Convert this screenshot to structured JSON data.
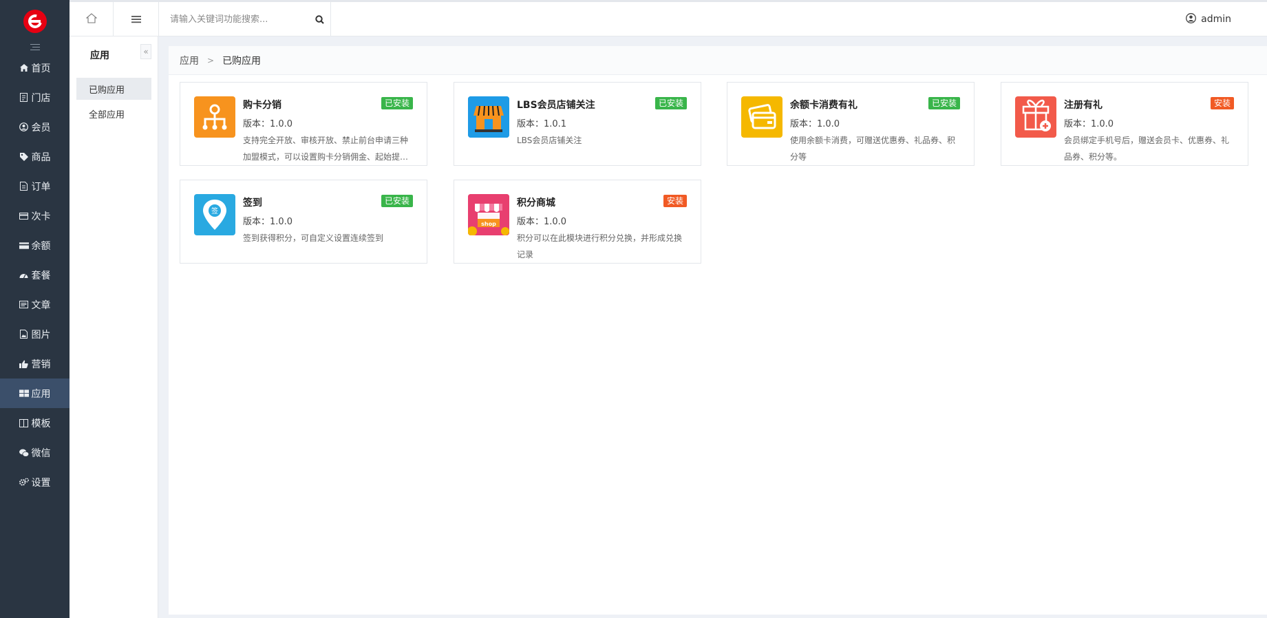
{
  "colors": {
    "sidebar_bg": "#2a3542",
    "sidebar_active": "#3b4f6a",
    "badge_installed": "#39b54a",
    "badge_install": "#f15a24"
  },
  "sidebar": {
    "logo_icon": "brand-logo-icon",
    "items": [
      {
        "label": "首页",
        "icon": "home-icon"
      },
      {
        "label": "门店",
        "icon": "store-icon"
      },
      {
        "label": "会员",
        "icon": "member-icon"
      },
      {
        "label": "商品",
        "icon": "tag-icon"
      },
      {
        "label": "订单",
        "icon": "order-icon"
      },
      {
        "label": "次卡",
        "icon": "card-icon"
      },
      {
        "label": "余额",
        "icon": "balance-icon"
      },
      {
        "label": "套餐",
        "icon": "package-icon"
      },
      {
        "label": "文章",
        "icon": "article-icon"
      },
      {
        "label": "图片",
        "icon": "image-icon"
      },
      {
        "label": "营销",
        "icon": "thumbs-up-icon"
      },
      {
        "label": "应用",
        "icon": "apps-grid-icon",
        "active": true
      },
      {
        "label": "模板",
        "icon": "template-icon"
      },
      {
        "label": "微信",
        "icon": "wechat-icon"
      },
      {
        "label": "设置",
        "icon": "settings-gears-icon"
      }
    ]
  },
  "header": {
    "search_placeholder": "请输入关键词功能搜索...",
    "user_name": "admin"
  },
  "subnav": {
    "title": "应用",
    "items": [
      {
        "label": "已购应用",
        "active": true
      },
      {
        "label": "全部应用"
      }
    ]
  },
  "breadcrumb": {
    "root": "应用",
    "current": "已购应用"
  },
  "apps": [
    {
      "title": "购卡分销",
      "badge": "已安装",
      "version": "版本：1.0.0",
      "desc": "支持完全开放、审核开放、禁止前台申请三种加盟模式，可以设置购卡分销佣金、起始提现金额等",
      "icon": "distribution-icon"
    },
    {
      "title": "LBS会员店铺关注",
      "badge": "已安装",
      "version": "版本：1.0.1",
      "desc": "LBS会员店铺关注",
      "icon": "storefront-icon"
    },
    {
      "title": "余额卡消费有礼",
      "badge": "已安装",
      "version": "版本：1.0.0",
      "desc": "使用余额卡消费，可赠送优惠券、礼品券、积分等",
      "icon": "wallet-card-icon"
    },
    {
      "title": "注册有礼",
      "badge": "安装",
      "version": "版本：1.0.0",
      "desc": "会员绑定手机号后，赠送会员卡、优惠券、礼品券、积分等。",
      "icon": "gift-icon"
    },
    {
      "title": "签到",
      "badge": "已安装",
      "version": "版本：1.0.0",
      "desc": "签到获得积分，可自定义设置连续签到",
      "icon": "checkin-pin-icon"
    },
    {
      "title": "积分商城",
      "badge": "安装",
      "version": "版本：1.0.0",
      "desc": "积分可以在此模块进行积分兑换，并形成兑换记录",
      "icon": "shop-icon",
      "icon_text": "shop",
      "pin_text": "签"
    }
  ]
}
